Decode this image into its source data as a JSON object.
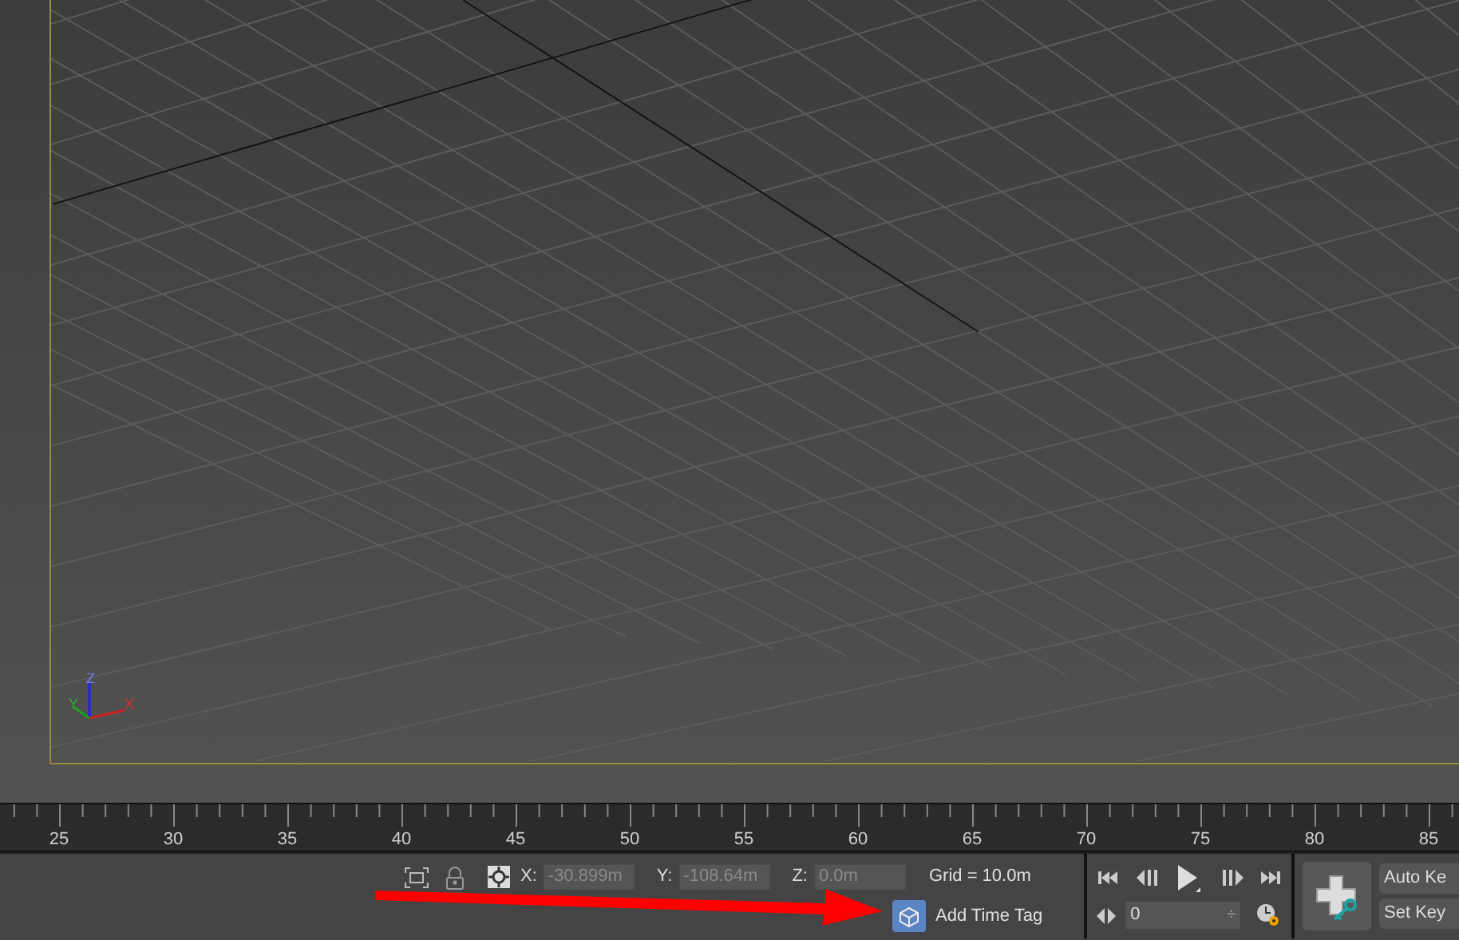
{
  "viewport": {
    "axis_labels": [
      "Z",
      "Y",
      "X"
    ]
  },
  "timeline": {
    "labels": [
      "25",
      "30",
      "35",
      "40",
      "45",
      "50",
      "55",
      "60",
      "65",
      "70",
      "75",
      "80",
      "85"
    ]
  },
  "status_bar": {
    "coords": [
      {
        "axis": "X:",
        "value": "-30.899m"
      },
      {
        "axis": "Y:",
        "value": "-108.64m"
      },
      {
        "axis": "Z:",
        "value": "0.0m"
      }
    ],
    "grid": "Grid = 10.0m",
    "time_tag": "Add Time Tag"
  },
  "playback": {
    "frame": "0",
    "spinner": "÷"
  },
  "keys": {
    "auto_key": "Auto Ke",
    "set_key": "Set Key"
  }
}
